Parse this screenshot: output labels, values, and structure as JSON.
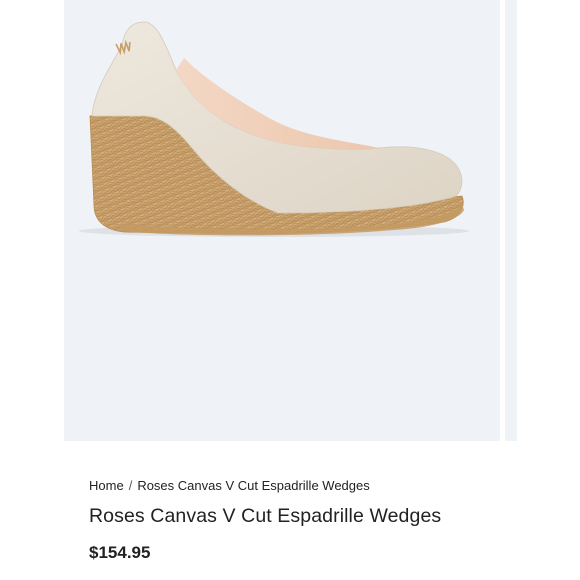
{
  "product": {
    "image_alt": "Roses Canvas V Cut Espadrille Wedges",
    "title": "Roses Canvas V Cut Espadrille Wedges",
    "price": "$154.95"
  },
  "breadcrumb": {
    "home": "Home",
    "separator": "/",
    "current": "Roses Canvas V Cut Espadrille Wedges"
  },
  "colors": {
    "gallery_bg": "#eff2f6",
    "canvas": "#e9e2d6",
    "jute": "#cfa873",
    "text": "#222222"
  }
}
